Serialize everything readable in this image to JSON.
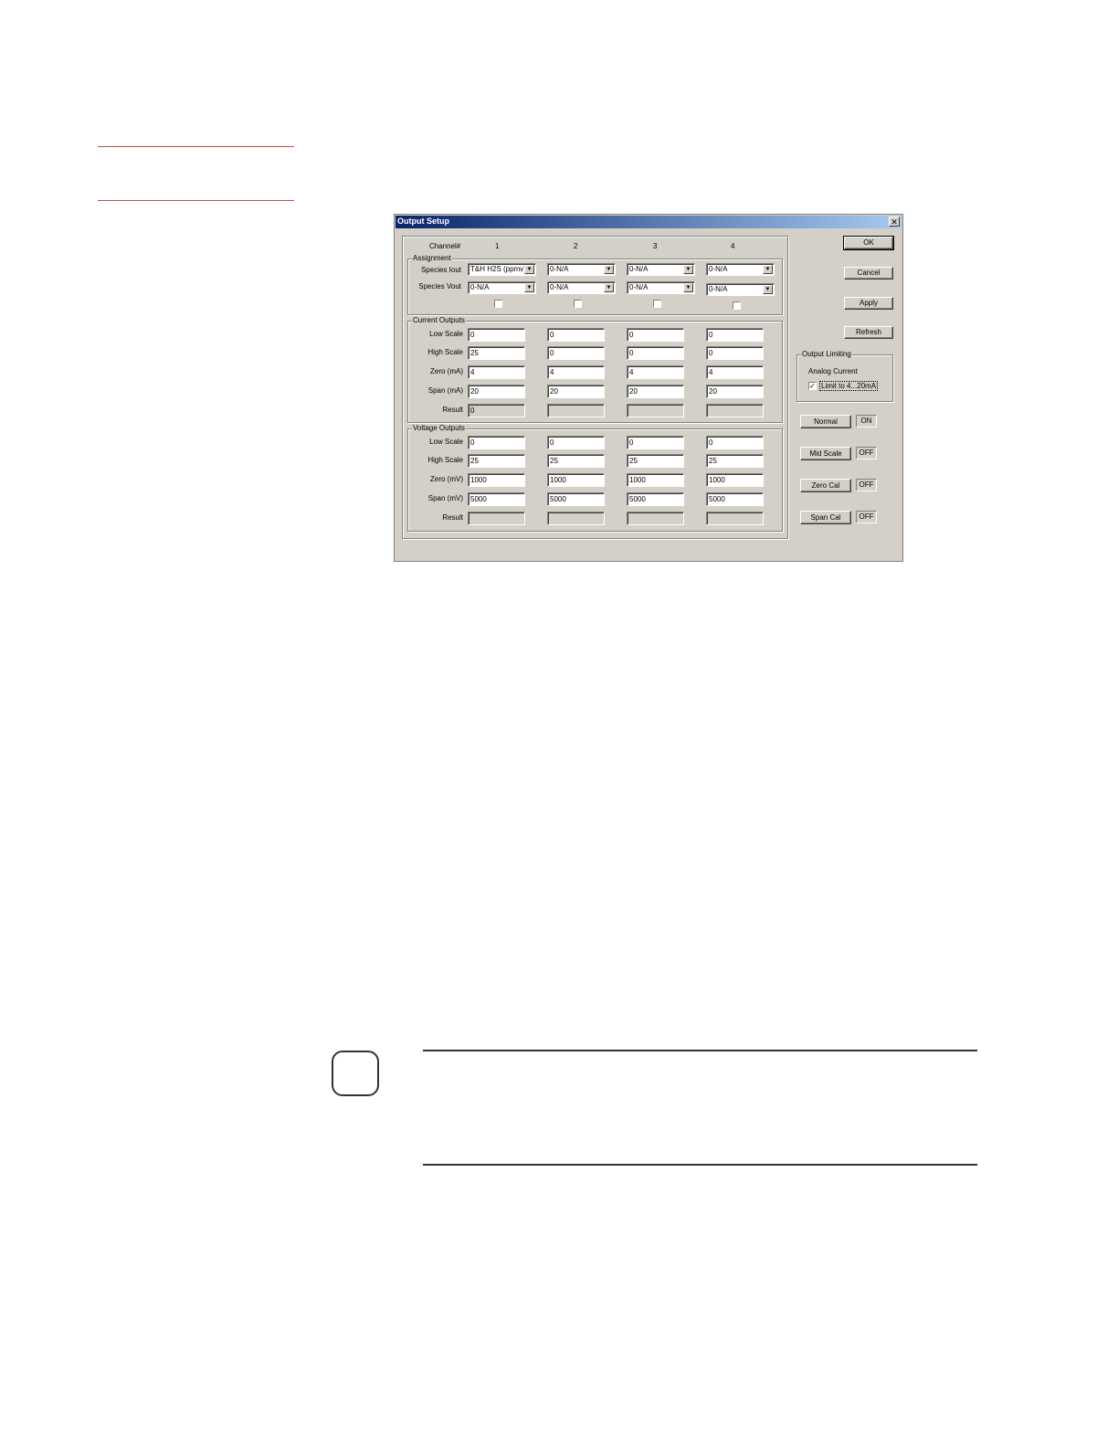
{
  "dialog": {
    "title": "Output Setup",
    "close_glyph": "✕",
    "channel_header": "Channel#",
    "channels": [
      "1",
      "2",
      "3",
      "4"
    ],
    "assignment": {
      "title": "Assignment",
      "iout_label": "Species Iout",
      "vout_label": "Species Vout",
      "iout": [
        "T&H H2S (ppmv)",
        "0-N/A",
        "0-N/A",
        "0-N/A"
      ],
      "vout": [
        "0-N/A",
        "0-N/A",
        "0-N/A",
        "0-N/A"
      ],
      "checkboxes": [
        false,
        false,
        false,
        false
      ]
    },
    "current_outputs": {
      "title": "Current Outputs",
      "labels": [
        "Low Scale",
        "High Scale",
        "Zero (mA)",
        "Span (mA)",
        "Result"
      ],
      "rows": [
        [
          "0",
          "0",
          "0",
          "0"
        ],
        [
          "25",
          "0",
          "0",
          "0"
        ],
        [
          "4",
          "4",
          "4",
          "4"
        ],
        [
          "20",
          "20",
          "20",
          "20"
        ],
        [
          "0",
          "",
          "",
          ""
        ]
      ]
    },
    "voltage_outputs": {
      "title": "Voltage Outputs",
      "labels": [
        "Low Scale",
        "High Scale",
        "Zero (mV)",
        "Span (mV)",
        "Result"
      ],
      "rows": [
        [
          "0",
          "0",
          "0",
          "0"
        ],
        [
          "25",
          "25",
          "25",
          "25"
        ],
        [
          "1000",
          "1000",
          "1000",
          "1000"
        ],
        [
          "5000",
          "5000",
          "5000",
          "5000"
        ],
        [
          "",
          "",
          "",
          ""
        ]
      ]
    },
    "buttons": {
      "ok": "OK",
      "cancel": "Cancel",
      "apply": "Apply",
      "refresh": "Refresh"
    },
    "output_limiting": {
      "title": "Output Limiting",
      "analog_label": "Analog Current",
      "limit_label": "Limit to 4...20mA",
      "limit_checked": true,
      "check_glyph": "✓"
    },
    "modes": [
      {
        "label": "Normal",
        "state": "ON"
      },
      {
        "label": "Mid Scale",
        "state": "OFF"
      },
      {
        "label": "Zero Cal",
        "state": "OFF"
      },
      {
        "label": "Span Cal",
        "state": "OFF"
      }
    ],
    "combo_arrow": "▼"
  },
  "colors": {
    "rule_red": "#c0504d",
    "dialog_face": "#d4d0c8",
    "title_dark": "#0a246a"
  }
}
